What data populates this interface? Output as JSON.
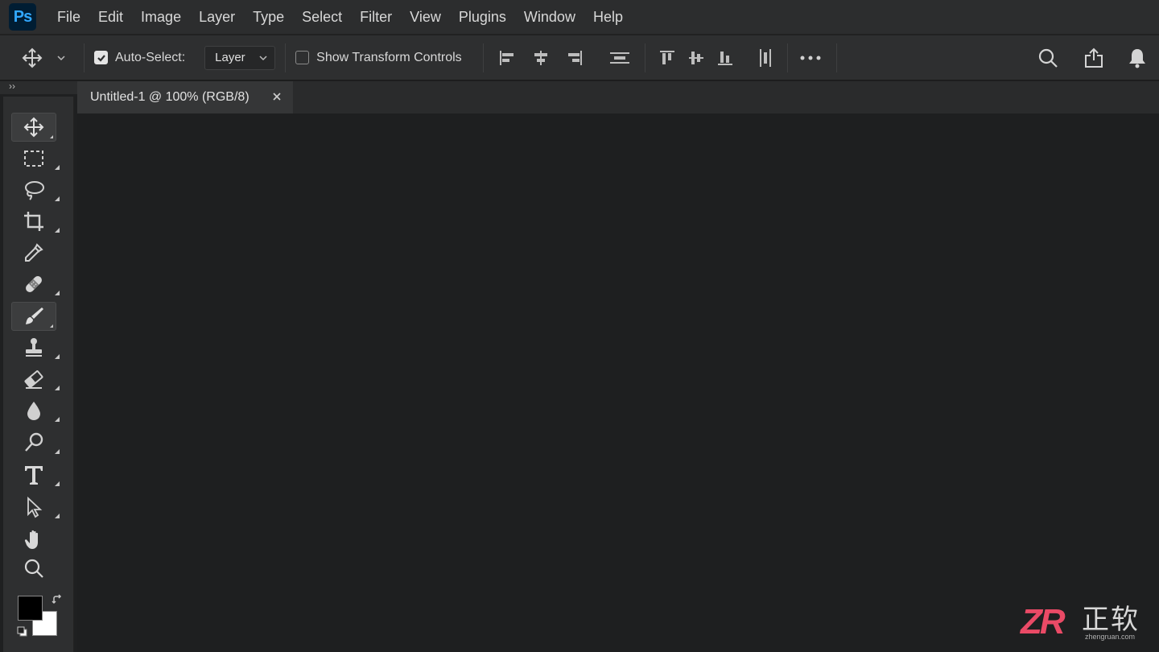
{
  "app": {
    "logo_text": "Ps",
    "accent": "#31a8ff"
  },
  "menubar": {
    "items": [
      "File",
      "Edit",
      "Image",
      "Layer",
      "Type",
      "Select",
      "Filter",
      "View",
      "Plugins",
      "Window",
      "Help"
    ]
  },
  "options": {
    "auto_select_label": "Auto-Select:",
    "auto_select_checked": true,
    "target_value": "Layer",
    "show_transform_label": "Show Transform Controls",
    "show_transform_checked": false
  },
  "document_tab": {
    "title": "Untitled-1 @ 100% (RGB/8)"
  },
  "tools": [
    "move-tool",
    "marquee-tool",
    "lasso-tool",
    "crop-tool",
    "eyedropper-tool",
    "healing-brush-tool",
    "brush-tool",
    "clone-stamp-tool",
    "eraser-tool",
    "blur-tool",
    "dodge-tool",
    "type-tool",
    "path-selection-tool",
    "hand-tool",
    "zoom-tool"
  ],
  "colors": {
    "foreground": "#000000",
    "background": "#ffffff"
  },
  "watermark": {
    "logo": "ZR",
    "cn": "正软",
    "url": "zhengruan.com"
  }
}
